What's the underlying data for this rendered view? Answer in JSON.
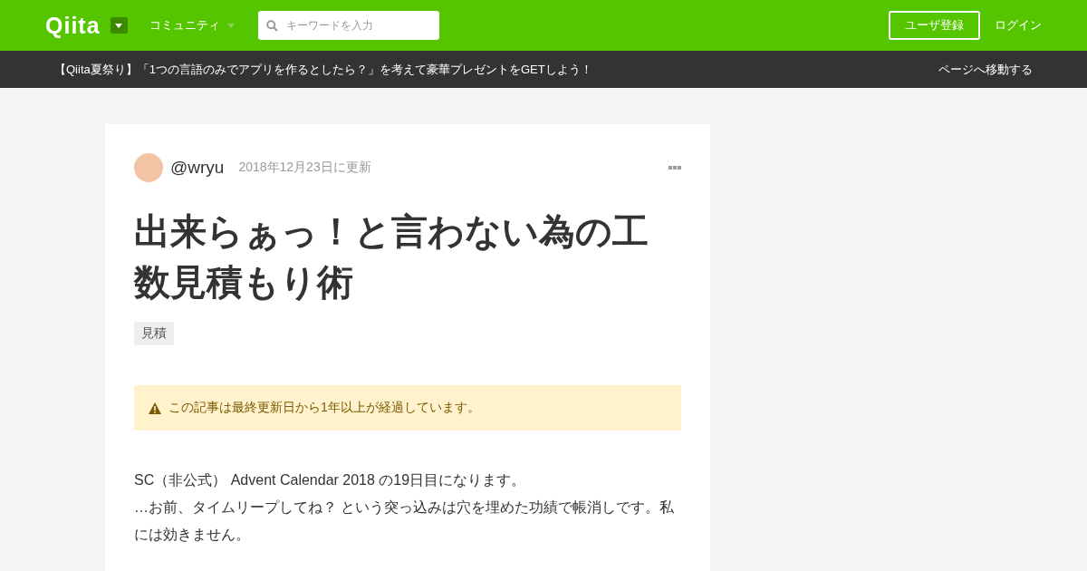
{
  "header": {
    "logo": "Qiita",
    "community_menu": "コミュニティ",
    "search": {
      "placeholder": "キーワードを入力"
    },
    "signup_button": "ユーザ登録",
    "login_link": "ログイン"
  },
  "banner": {
    "text": "【Qiita夏祭り】「1つの言語のみでアプリを作るとしたら？」を考えて豪華プレゼントをGETしよう！",
    "link": "ページへ移動する"
  },
  "article": {
    "author": "@wryu",
    "updated": "2018年12月23日に更新",
    "title": "出来らぁっ！と言わない為の工数見積もり術",
    "tags": [
      "見積"
    ],
    "notice": "この記事は最終更新日から1年以上が経過しています。",
    "body": [
      "SC（非公式） Advent Calendar 2018 の19日目になります。",
      "…お前、タイムリープしてね？ という突っ込みは穴を埋めた功績で帳消しです。私には効きません。"
    ]
  }
}
